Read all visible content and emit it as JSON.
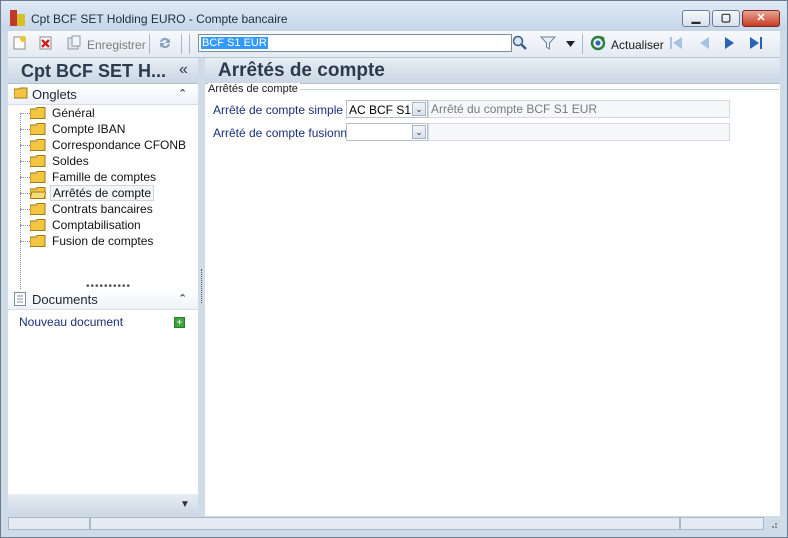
{
  "window": {
    "title": "Cpt BCF SET Holding EURO -  Compte bancaire",
    "min_glyph": "▁",
    "max_glyph": "▢",
    "close_glyph": "✕"
  },
  "toolbar": {
    "save_label": "Enregistrer",
    "search_value": "BCF S1 EUR",
    "refresh_label": "Actualiser"
  },
  "left_panel": {
    "title": "Cpt BCF SET H...",
    "collapse_glyph": "«",
    "onglets": {
      "label": "Onglets",
      "chevron": "⌃",
      "items": [
        {
          "label": "Général"
        },
        {
          "label": "Compte IBAN"
        },
        {
          "label": "Correspondance CFONB"
        },
        {
          "label": "Soldes"
        },
        {
          "label": "Famille de comptes"
        },
        {
          "label": "Arrêtés de compte",
          "selected": true
        },
        {
          "label": "Contrats bancaires"
        },
        {
          "label": "Comptabilisation"
        },
        {
          "label": "Fusion de comptes"
        }
      ]
    },
    "splitter": "••••••••••",
    "documents": {
      "label": "Documents",
      "chevron": "⌃",
      "new_doc": "Nouveau document",
      "plus": "+"
    },
    "bottom_chevron": "▼"
  },
  "main": {
    "title": "Arrêtés de compte",
    "group_caption": "Arrêtés de compte",
    "fields": [
      {
        "label": "Arrêté de compte simple",
        "value": "AC BCF S1",
        "description": "Arrêté du compte BCF S1 EUR"
      },
      {
        "label": "Arrêté de compte fusionné",
        "value": "",
        "description": ""
      }
    ],
    "drop_glyph": "⌄"
  },
  "colors": {
    "accent": "#1a2f7a",
    "title_text": "#2b3a4c",
    "selection": "#3399ff"
  }
}
